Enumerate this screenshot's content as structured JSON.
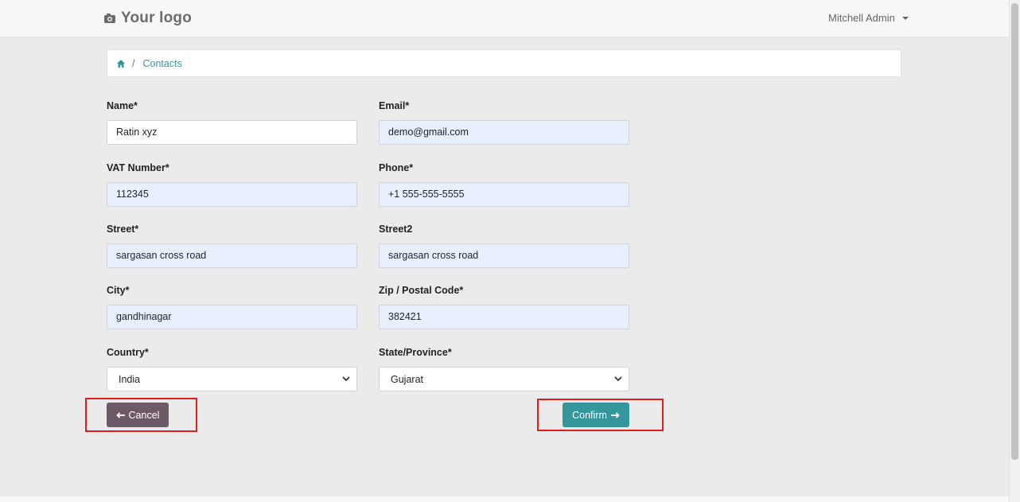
{
  "header": {
    "logo_text": "Your logo",
    "logo_icon": "camera-icon",
    "user_name": "Mitchell Admin"
  },
  "breadcrumb": {
    "home_icon": "home-icon",
    "separator": "/",
    "current": "Contacts"
  },
  "form": {
    "name": {
      "label": "Name*",
      "value": "Ratin xyz"
    },
    "email": {
      "label": "Email*",
      "value": "demo@gmail.com"
    },
    "vat": {
      "label": "VAT Number*",
      "value": "112345"
    },
    "phone": {
      "label": "Phone*",
      "value": "+1 555-555-5555"
    },
    "street": {
      "label": "Street*",
      "value": "sargasan cross road"
    },
    "street2": {
      "label": "Street2",
      "value": "sargasan cross road"
    },
    "city": {
      "label": "City*",
      "value": "gandhinagar"
    },
    "zip": {
      "label": "Zip / Postal Code*",
      "value": "382421"
    },
    "country": {
      "label": "Country*",
      "value": "India"
    },
    "state": {
      "label": "State/Province*",
      "value": "Gujarat"
    }
  },
  "actions": {
    "cancel_label": "Cancel",
    "confirm_label": "Confirm"
  },
  "colors": {
    "accent": "#35979c",
    "cancel": "#6c5b66",
    "highlight": "#e01e1e",
    "autofill": "#e8f0fe"
  }
}
